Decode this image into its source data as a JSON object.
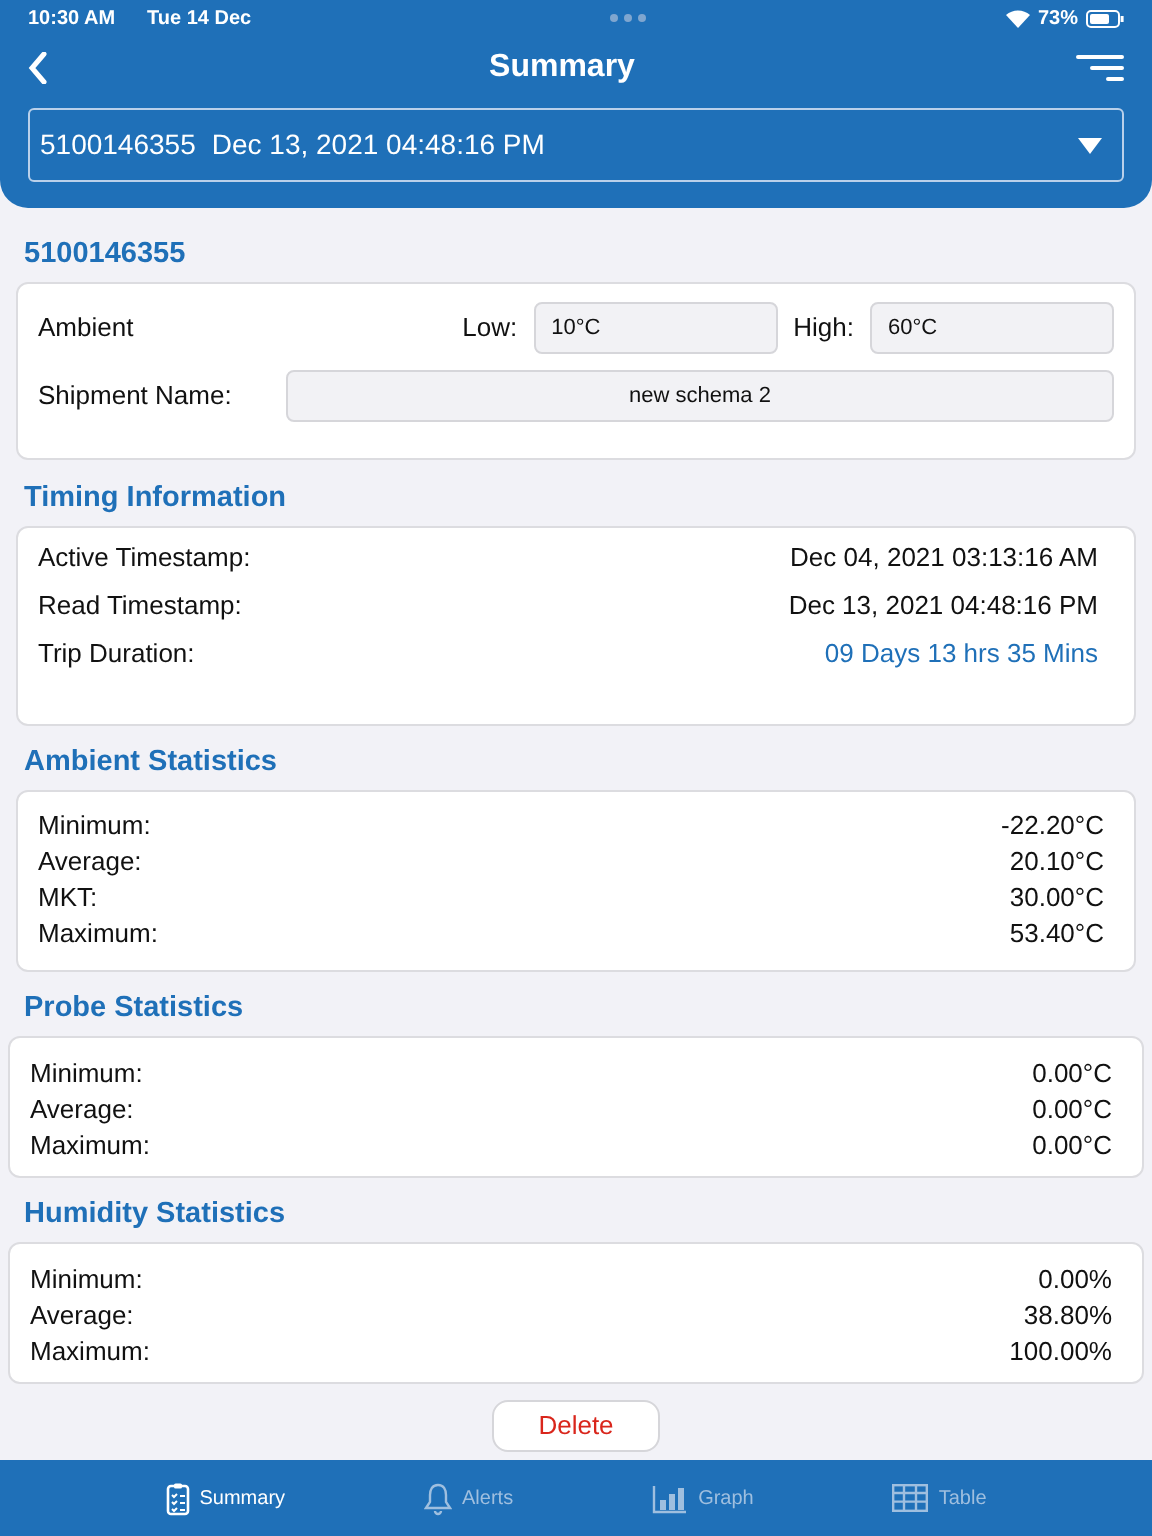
{
  "status_bar": {
    "time": "10:30 AM",
    "date": "Tue 14 Dec",
    "battery": "73%"
  },
  "header": {
    "title": "Summary",
    "selector": {
      "id": "5100146355",
      "timestamp": "Dec 13, 2021 04:48:16 PM"
    }
  },
  "device": {
    "title": "5100146355",
    "sensor": "Ambient",
    "low_label": "Low:",
    "low": "10°C",
    "high_label": "High:",
    "high": "60°C",
    "shipment_label": "Shipment Name:",
    "shipment": "new schema 2"
  },
  "timing": {
    "title": "Timing Information",
    "rows": [
      {
        "label": "Active Timestamp:",
        "value": "Dec 04, 2021 03:13:16 AM",
        "highlight": false
      },
      {
        "label": "Read Timestamp:",
        "value": "Dec 13, 2021 04:48:16 PM",
        "highlight": false
      },
      {
        "label": "Trip Duration:",
        "value": "09 Days 13 hrs 35 Mins",
        "highlight": true
      }
    ]
  },
  "stat_sections": [
    {
      "title": "Ambient Statistics",
      "rows": [
        {
          "label": "Minimum:",
          "value": "-22.20°C"
        },
        {
          "label": "Average:",
          "value": "20.10°C"
        },
        {
          "label": "MKT:",
          "value": "30.00°C"
        },
        {
          "label": "Maximum:",
          "value": "53.40°C"
        }
      ]
    },
    {
      "title": "Probe Statistics",
      "rows": [
        {
          "label": "Minimum:",
          "value": "0.00°C"
        },
        {
          "label": "Average:",
          "value": "0.00°C"
        },
        {
          "label": "Maximum:",
          "value": "0.00°C"
        }
      ]
    },
    {
      "title": "Humidity Statistics",
      "rows": [
        {
          "label": "Minimum:",
          "value": "0.00%"
        },
        {
          "label": "Average:",
          "value": "38.80%"
        },
        {
          "label": "Maximum:",
          "value": "100.00%"
        }
      ]
    }
  ],
  "delete_button": "Delete",
  "tabs": [
    {
      "label": "Summary",
      "selected": true
    },
    {
      "label": "Alerts",
      "selected": false
    },
    {
      "label": "Graph",
      "selected": false
    },
    {
      "label": "Table",
      "selected": false
    }
  ]
}
